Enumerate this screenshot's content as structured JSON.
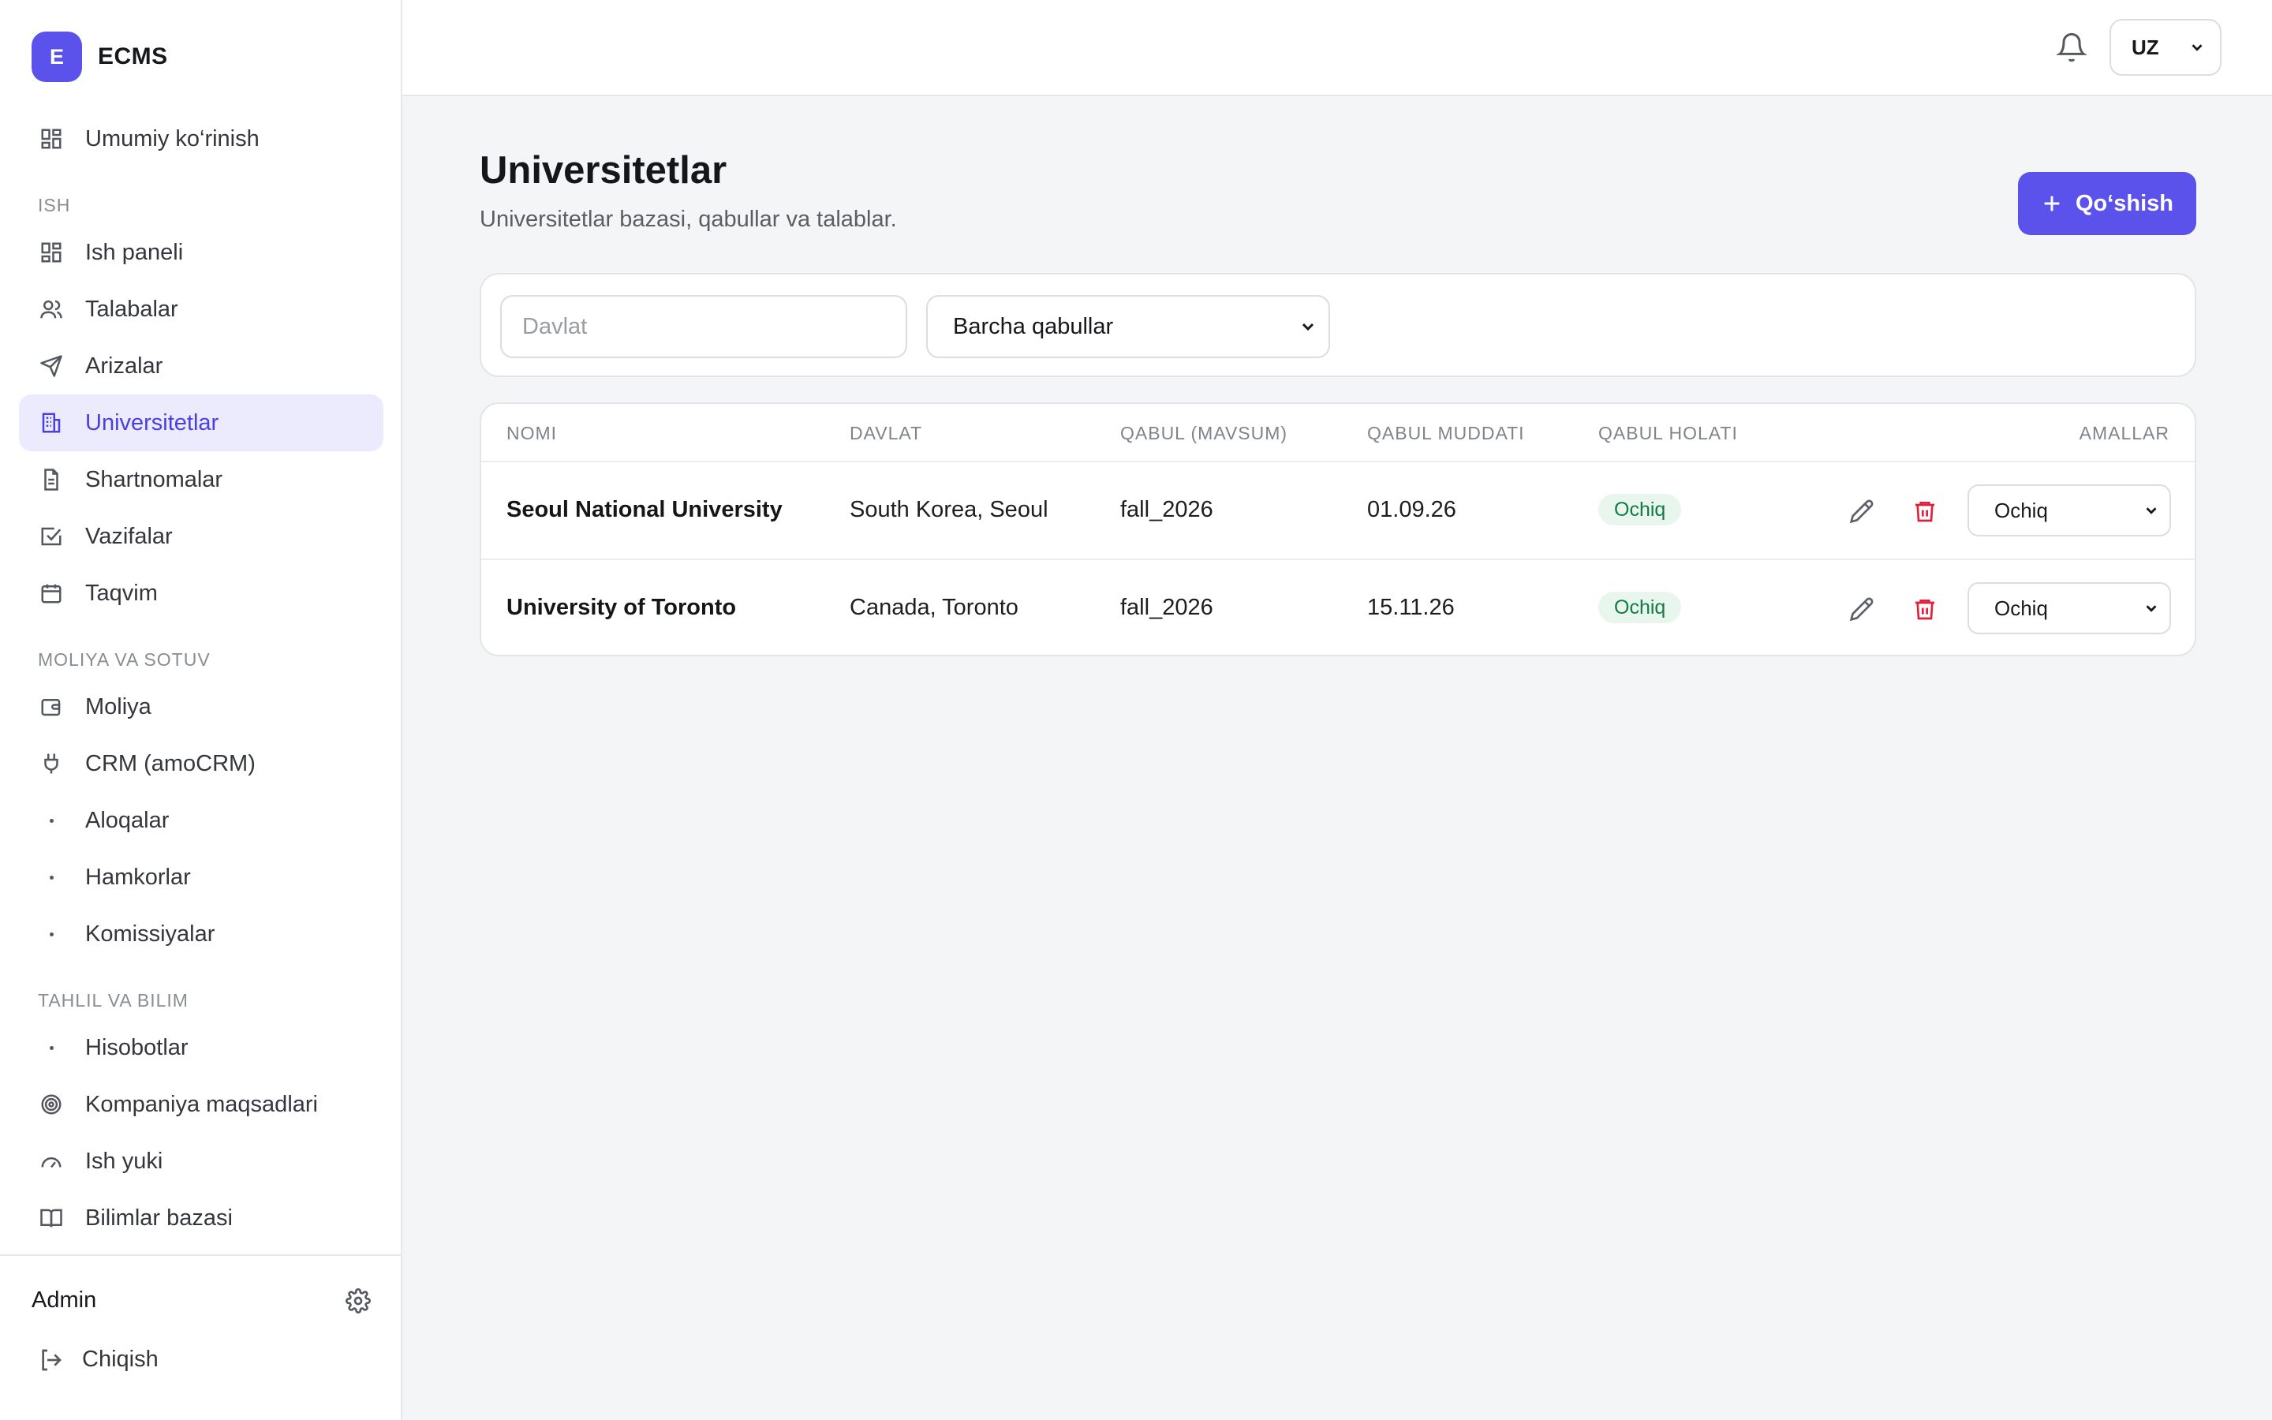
{
  "app": {
    "logo_letter": "E",
    "name": "ECMS"
  },
  "sidebar": {
    "overview": "Umumiy ko‘rinish",
    "sections": {
      "work": "ISH",
      "finance": "MOLIYA VA SOTUV",
      "analytics": "TAHLIL VA BILIM"
    },
    "items": [
      {
        "label": "Ish paneli",
        "icon": "dashboard-icon"
      },
      {
        "label": "Talabalar",
        "icon": "users-icon"
      },
      {
        "label": "Arizalar",
        "icon": "send-icon"
      },
      {
        "label": "Universitetlar",
        "icon": "building-icon",
        "active": true
      },
      {
        "label": "Shartnomalar",
        "icon": "document-icon"
      },
      {
        "label": "Vazifalar",
        "icon": "checkbox-icon"
      },
      {
        "label": "Taqvim",
        "icon": "calendar-icon"
      },
      {
        "label": "Moliya",
        "icon": "wallet-icon"
      },
      {
        "label": "CRM (amoCRM)",
        "icon": "plug-icon"
      },
      {
        "label": "Aloqalar",
        "icon": "dot-icon"
      },
      {
        "label": "Hamkorlar",
        "icon": "dot-icon"
      },
      {
        "label": "Komissiyalar",
        "icon": "dot-icon"
      },
      {
        "label": "Hisobotlar",
        "icon": "dot-icon"
      },
      {
        "label": "Kompaniya maqsadlari",
        "icon": "target-icon"
      },
      {
        "label": "Ish yuki",
        "icon": "gauge-icon"
      },
      {
        "label": "Bilimlar bazasi",
        "icon": "book-icon"
      }
    ],
    "footer": {
      "user": "Admin",
      "logout": "Chiqish"
    }
  },
  "topbar": {
    "language": "UZ"
  },
  "page": {
    "title": "Universitetlar",
    "subtitle": "Universitetlar bazasi, qabullar va talablar.",
    "add_button": "Qo‘shish"
  },
  "filters": {
    "country_placeholder": "Davlat",
    "country_value": "",
    "intake_value": "Barcha qabullar"
  },
  "table": {
    "columns": [
      "NOMI",
      "DAVLAT",
      "QABUL (MAVSUM)",
      "QABUL MUDDATI",
      "QABUL HOLATI",
      "AMALLAR"
    ],
    "rows": [
      {
        "name": "Seoul National University",
        "country": "South Korea, Seoul",
        "intake": "fall_2026",
        "deadline": "01.09.26",
        "status": "Ochiq",
        "status_select": "Ochiq"
      },
      {
        "name": "University of Toronto",
        "country": "Canada, Toronto",
        "intake": "fall_2026",
        "deadline": "15.11.26",
        "status": "Ochiq",
        "status_select": "Ochiq"
      }
    ]
  },
  "colors": {
    "accent": "#5b52ec",
    "active_bg": "#ecebfd",
    "badge_bg": "#e8f6ee",
    "badge_text": "#137a45",
    "danger": "#e0203a"
  }
}
